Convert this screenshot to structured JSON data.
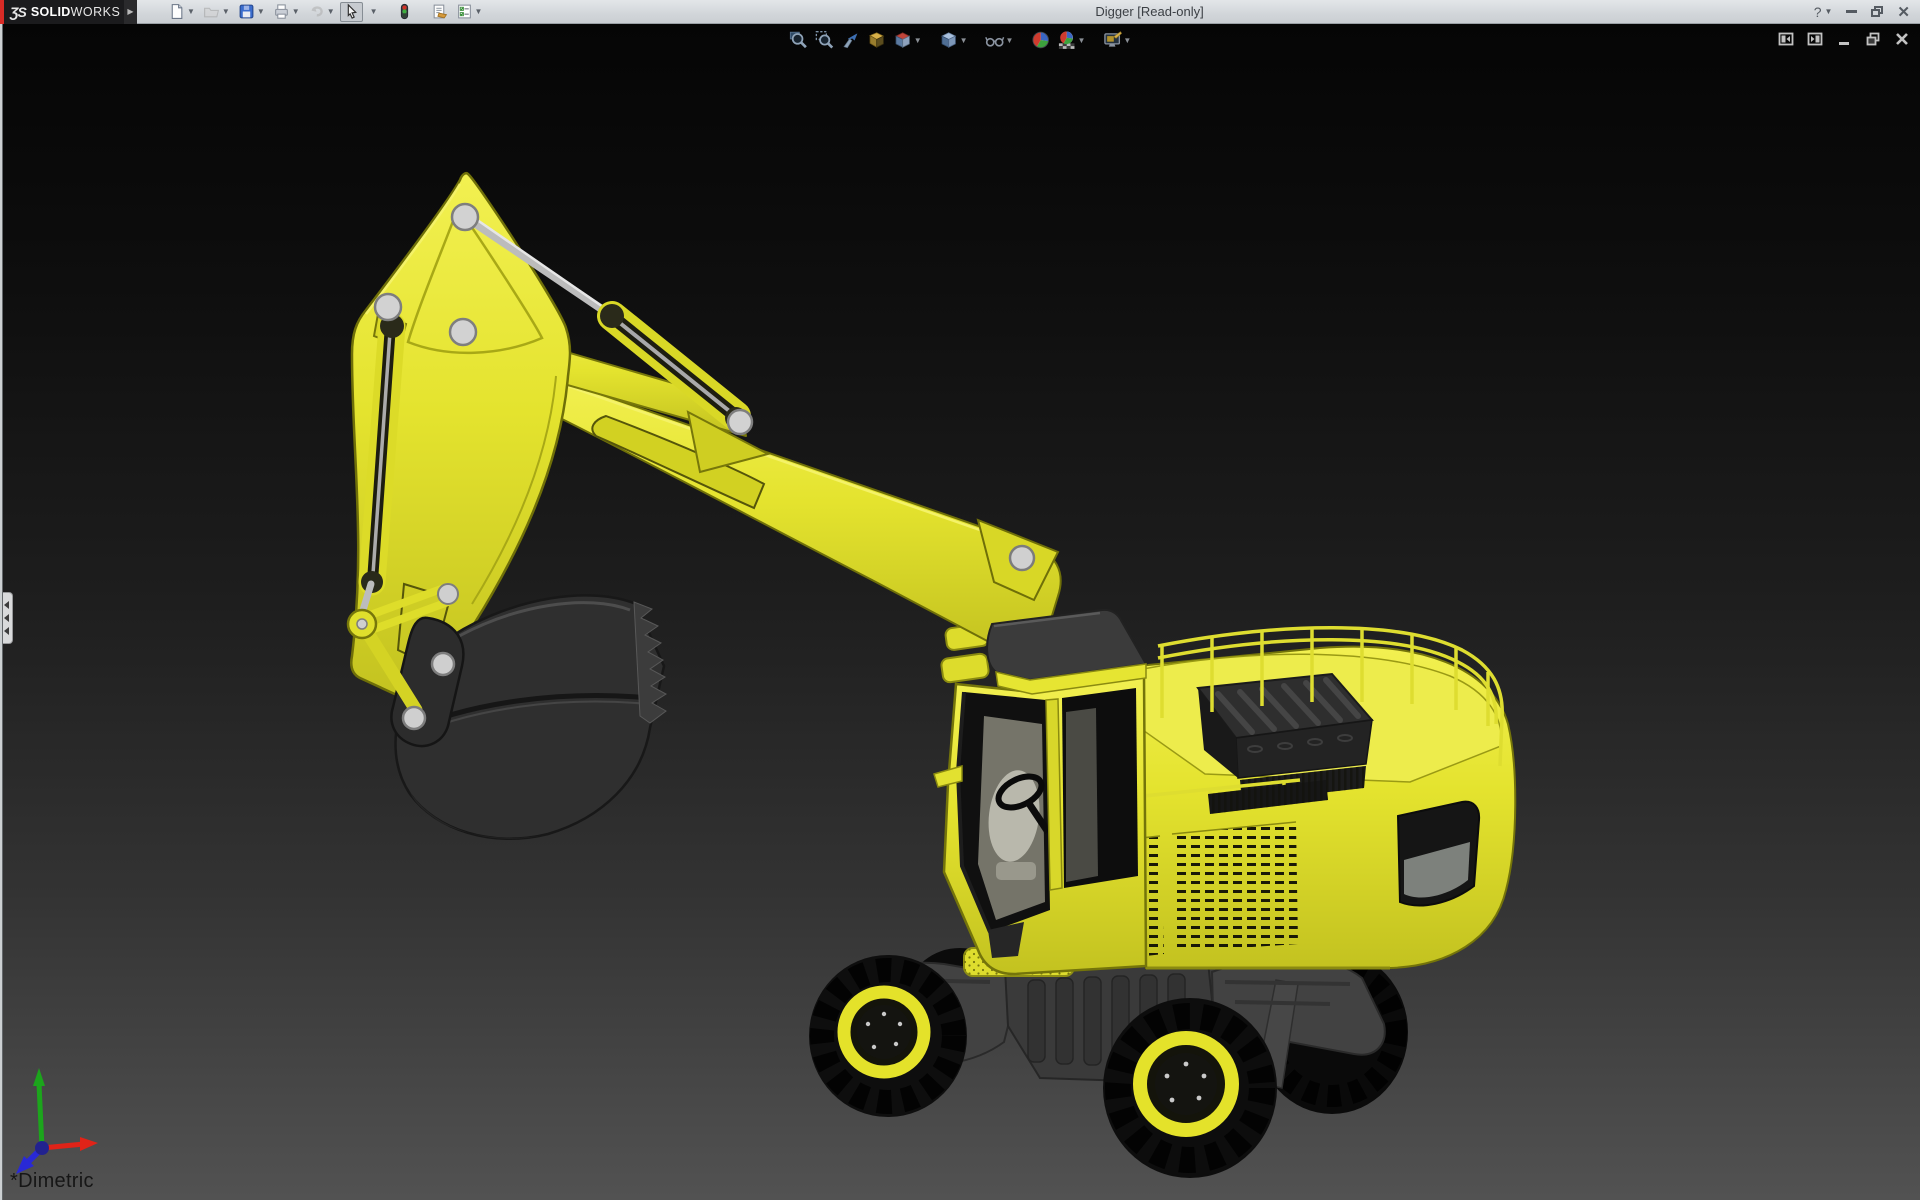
{
  "window": {
    "title": "Digger [Read-only]",
    "brand": {
      "logo_mark": "ƷS",
      "name_bold": "SOLID",
      "name_light": "WORKS"
    },
    "help_glyph": "?"
  },
  "main_toolbar": {
    "items": [
      {
        "name": "new-document",
        "dropdown": true,
        "enabled": true,
        "active": false
      },
      {
        "name": "open",
        "dropdown": true,
        "enabled": false,
        "active": false
      },
      {
        "name": "save",
        "dropdown": true,
        "enabled": true,
        "active": false
      },
      {
        "name": "print",
        "dropdown": true,
        "enabled": true,
        "active": false
      },
      {
        "name": "undo",
        "dropdown": true,
        "enabled": false,
        "active": false
      },
      {
        "name": "select",
        "dropdown": true,
        "enabled": true,
        "active": true
      },
      {
        "name": "rebuild",
        "dropdown": false,
        "enabled": true,
        "active": false
      },
      {
        "name": "file-properties",
        "dropdown": false,
        "enabled": true,
        "active": false
      },
      {
        "name": "options",
        "dropdown": true,
        "enabled": true,
        "active": false
      }
    ]
  },
  "headsup_toolbar": {
    "items": [
      {
        "name": "zoom-to-fit",
        "dropdown": false
      },
      {
        "name": "zoom-to-area",
        "dropdown": false
      },
      {
        "name": "previous-view",
        "dropdown": false
      },
      {
        "name": "section-view",
        "dropdown": false
      },
      {
        "name": "view-orientation",
        "dropdown": true
      },
      {
        "name": "display-style",
        "dropdown": true
      },
      {
        "name": "hide-show-items",
        "dropdown": true
      },
      {
        "name": "edit-appearance",
        "dropdown": false
      },
      {
        "name": "apply-scene",
        "dropdown": true
      },
      {
        "name": "view-settings",
        "dropdown": true
      }
    ]
  },
  "titlebar_controls": [
    "help",
    "minimize-window",
    "restore-window",
    "close-window"
  ],
  "document_controls": [
    "previous-window",
    "next-window",
    "minimize-document",
    "restore-document",
    "close-document"
  ],
  "viewport": {
    "orientation_label": "*Dimetric",
    "triad": {
      "x_color": "#e02318",
      "y_color": "#1ca51c",
      "z_color": "#2929d6"
    },
    "background_top": "#050505",
    "background_bottom": "#525252"
  },
  "model": {
    "name": "Digger",
    "primary_color": "#e4e32e",
    "dark_parts_color": "#2f2f2f",
    "pin_color": "#d2d2d2",
    "rim_color": "#e4e22a",
    "tire_color": "#0e0e0e"
  }
}
